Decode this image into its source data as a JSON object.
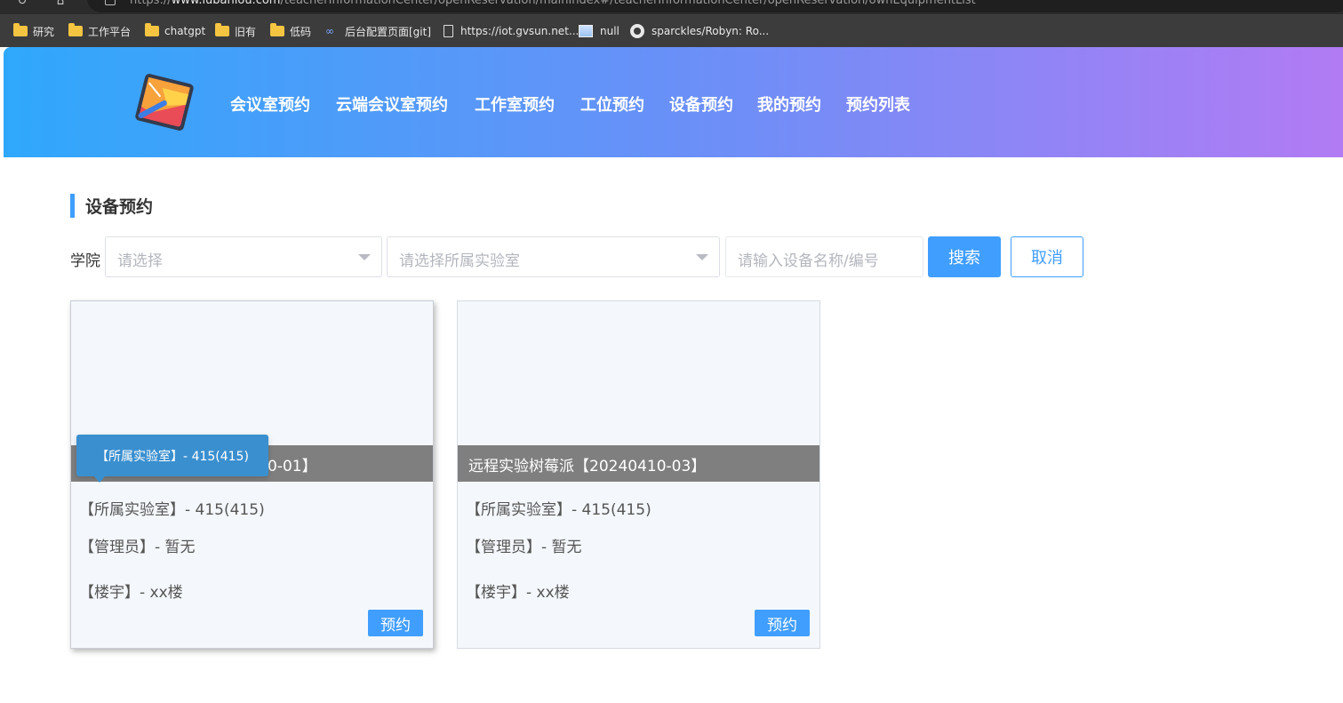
{
  "browser": {
    "url_prefix": "https://",
    "url_host": "www.lubanlou.com",
    "url_path": "/teacherInformationCenter/openReservation/mainIndex#/teacherInformationCenter/openReservation/ownEquipmentList",
    "bookmarks": [
      {
        "label": "研究",
        "icon": "folder-icon"
      },
      {
        "label": "工作平台",
        "icon": "folder-icon"
      },
      {
        "label": "chatgpt",
        "icon": "folder-icon"
      },
      {
        "label": "旧有",
        "icon": "folder-icon"
      },
      {
        "label": "低码",
        "icon": "folder-icon"
      },
      {
        "label": "后台配置页面[git]",
        "icon": "link-icon"
      },
      {
        "label": "https://iot.gvsun.net...",
        "icon": "page-icon"
      },
      {
        "label": "null",
        "icon": "image-icon"
      },
      {
        "label": "sparckles/Robyn: Ro...",
        "icon": "github-icon"
      }
    ]
  },
  "nav": {
    "items": [
      "会议室预约",
      "云端会议室预约",
      "工作室预约",
      "工位预约",
      "设备预约",
      "我的预约",
      "预约列表"
    ]
  },
  "page": {
    "title": "设备预约",
    "filter_label": "学院",
    "college_placeholder": "请选择",
    "lab_placeholder": "请选择所属实验室",
    "search_placeholder": "请输入设备名称/编号",
    "search_button": "搜索",
    "cancel_button": "取消"
  },
  "cards": [
    {
      "name": "远程实验树莓派【20240410-01】",
      "name_visible": "0-01】",
      "lab": "【所属实验室】- 415(415)",
      "manager": "【管理员】- 暂无",
      "building": "【楼宇】- xx楼",
      "button": "预约"
    },
    {
      "name": "远程实验树莓派【20240410-03】",
      "lab": "【所属实验室】- 415(415)",
      "manager": "【管理员】- 暂无",
      "building": "【楼宇】- xx楼",
      "button": "预约"
    }
  ],
  "tooltip": {
    "text": "【所属实验室】- 415(415)"
  }
}
